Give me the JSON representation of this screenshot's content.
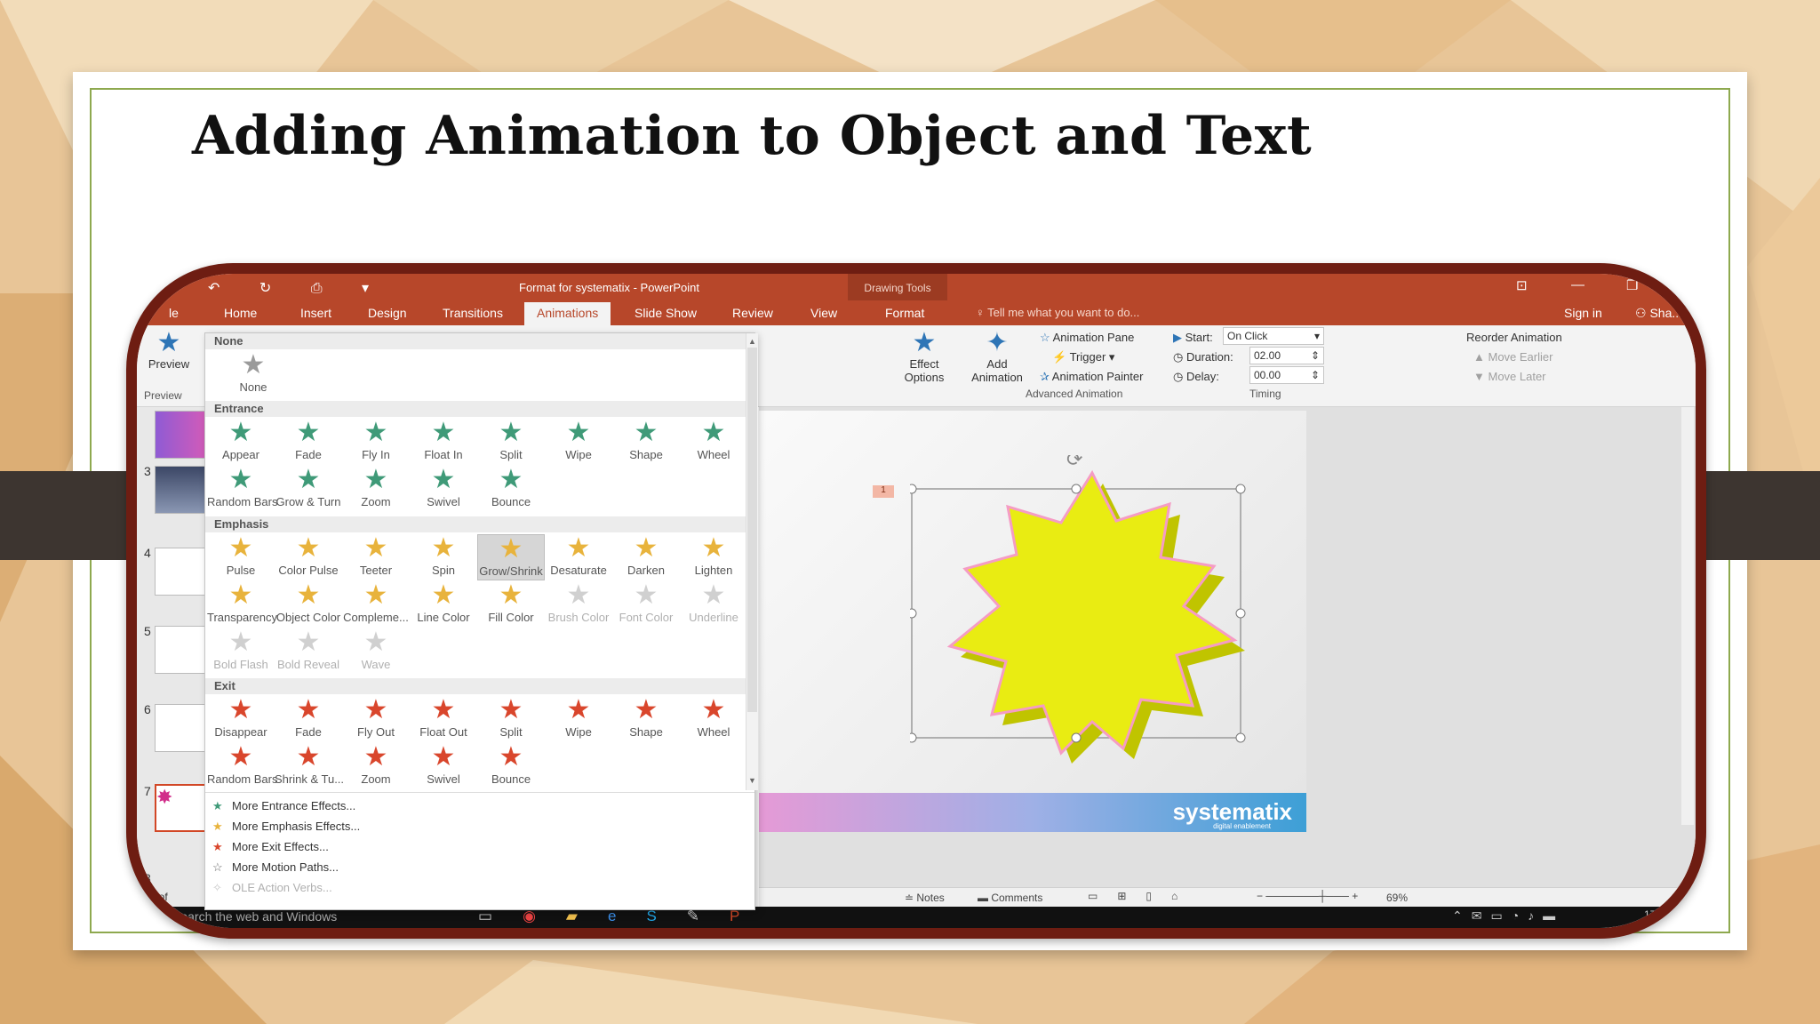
{
  "slide": {
    "title": "Adding Animation to Object and Text"
  },
  "app": {
    "doc_title": "Format for systematix - PowerPoint",
    "context_tab_header": "Drawing Tools",
    "tabs": [
      "le",
      "Home",
      "Insert",
      "Design",
      "Transitions",
      "Animations",
      "Slide Show",
      "Review",
      "View",
      "Format"
    ],
    "active_tab": "Animations",
    "tell_me": "Tell me what you want to do...",
    "sign_in": "Sign in",
    "share": "Sha..."
  },
  "ribbon": {
    "preview": "Preview",
    "preview_group": "Preview",
    "effect_options_l1": "Effect",
    "effect_options_l2": "Options",
    "add_animation_l1": "Add",
    "add_animation_l2": "Animation",
    "animation_pane": "Animation Pane",
    "trigger": "Trigger",
    "animation_painter": "Animation Painter",
    "advanced_group": "Advanced Animation",
    "start_label": "Start:",
    "start_value": "On Click",
    "duration_label": "Duration:",
    "duration_value": "02.00",
    "delay_label": "Delay:",
    "delay_value": "00.00",
    "timing_group": "Timing",
    "reorder": "Reorder Animation",
    "move_earlier": "Move Earlier",
    "move_later": "Move Later"
  },
  "gallery": {
    "sections": {
      "none": "None",
      "entrance": "Entrance",
      "emphasis": "Emphasis",
      "exit": "Exit"
    },
    "none_label": "None",
    "entrance": [
      "Appear",
      "Fade",
      "Fly In",
      "Float In",
      "Split",
      "Wipe",
      "Shape",
      "Wheel",
      "Random Bars",
      "Grow & Turn",
      "Zoom",
      "Swivel",
      "Bounce"
    ],
    "emphasis": [
      "Pulse",
      "Color Pulse",
      "Teeter",
      "Spin",
      "Grow/Shrink",
      "Desaturate",
      "Darken",
      "Lighten",
      "Transparency",
      "Object Color",
      "Compleme...",
      "Line Color",
      "Fill Color",
      "Brush Color",
      "Font Color",
      "Underline",
      "Bold Flash",
      "Bold Reveal",
      "Wave"
    ],
    "exit": [
      "Disappear",
      "Fade",
      "Fly Out",
      "Float Out",
      "Split",
      "Wipe",
      "Shape",
      "Wheel",
      "Random Bars",
      "Shrink & Tu...",
      "Zoom",
      "Swivel",
      "Bounce"
    ],
    "selected": "Grow/Shrink",
    "more": [
      "More Entrance Effects...",
      "More Emphasis Effects...",
      "More Exit Effects...",
      "More Motion Paths...",
      "OLE Action Verbs..."
    ],
    "colors": {
      "entrance": "#3f9a78",
      "emphasis": "#e8b33c",
      "exit": "#d9462c",
      "none": "#9a9a9a"
    }
  },
  "thumbnails": {
    "numbers": [
      "3",
      "4",
      "5",
      "6",
      "7",
      "8"
    ],
    "slide_counter": "le 7 of"
  },
  "canvas": {
    "anim_tag": "1",
    "brand": "systematix",
    "tagline": "digital enablement",
    "star_color": "#e6e60a"
  },
  "statusbar": {
    "notes": "Notes",
    "comments": "Comments",
    "zoom": "69%"
  },
  "taskbar": {
    "search": "Search the web and Windows",
    "time": "17:"
  }
}
